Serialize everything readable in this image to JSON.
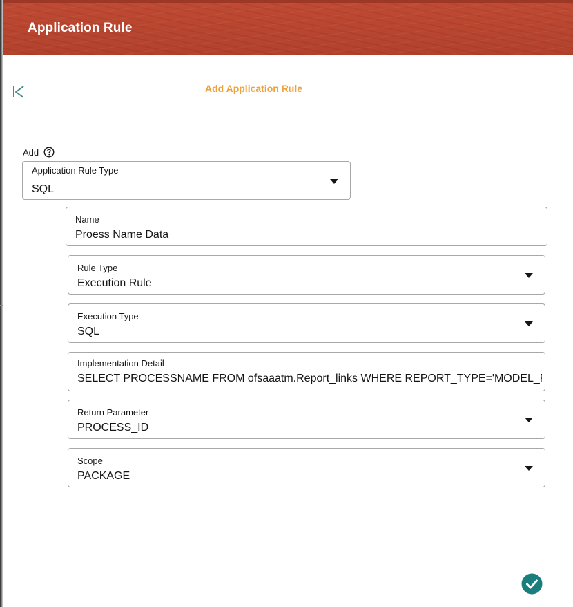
{
  "header": {
    "title": "Application Rule"
  },
  "panel": {
    "title": "Add Application Rule"
  },
  "form": {
    "add_label": "Add",
    "application_rule_type": {
      "label": "Application Rule Type",
      "value": "SQL"
    },
    "name": {
      "label": "Name",
      "value": "Proess Name Data"
    },
    "rule_type": {
      "label": "Rule Type",
      "value": "Execution Rule"
    },
    "execution_type": {
      "label": "Execution Type",
      "value": "SQL"
    },
    "implementation_detail": {
      "label": "Implementation Detail",
      "value": "SELECT PROCESSNAME FROM ofsaaatm.Report_links WHERE REPORT_TYPE='MODEL_PROCESS'"
    },
    "return_parameter": {
      "label": "Return Parameter",
      "value": "PROCESS_ID"
    },
    "scope": {
      "label": "Scope",
      "value": "PACKAGE"
    }
  },
  "colors": {
    "header_bg": "#b9452f",
    "accent": "#eea23c",
    "save_button": "#1a7e7d",
    "back_icon": "#4f8a8b"
  },
  "icons": {
    "back": "skip-back-icon",
    "help": "question-circle-icon",
    "dropdown": "caret-down-icon",
    "save": "check-circle-icon"
  }
}
